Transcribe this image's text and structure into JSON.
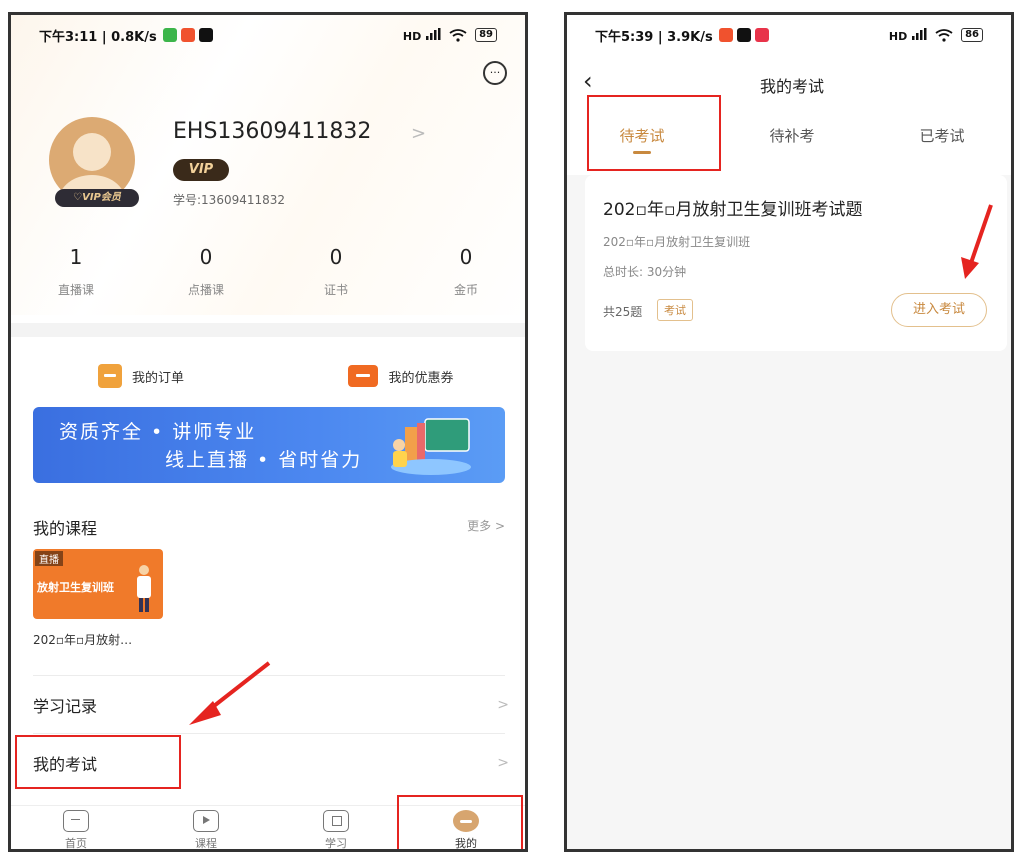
{
  "left": {
    "status": {
      "time_speed": "下午3:11 | 0.8K/s",
      "signal": "HD",
      "battery": "89"
    },
    "profile": {
      "username": "EHS13609411832",
      "vip_badge": "VIP",
      "vip_member_label": "♡VIP会员",
      "student_id": "学号:13609411832"
    },
    "stats": [
      {
        "value": "1",
        "label": "直播课"
      },
      {
        "value": "0",
        "label": "点播课"
      },
      {
        "value": "0",
        "label": "证书"
      },
      {
        "value": "0",
        "label": "金币"
      }
    ],
    "actions": {
      "orders": "我的订单",
      "coupons": "我的优惠券"
    },
    "banner": {
      "line1": "资质齐全 • 讲师专业",
      "line2": "线上直播 • 省时省力"
    },
    "courses": {
      "title": "我的课程",
      "more": "更多 >",
      "item": {
        "tag": "直播",
        "thumb_text": "放射卫生复训班",
        "name": "202▫年▫月放射…"
      }
    },
    "menu": {
      "study_record": "学习记录",
      "my_exams": "我的考试"
    },
    "tabbar": [
      {
        "label": "首页"
      },
      {
        "label": "课程"
      },
      {
        "label": "学习"
      },
      {
        "label": "我的"
      }
    ]
  },
  "right": {
    "status": {
      "time_speed": "下午5:39 | 3.9K/s",
      "signal": "HD",
      "battery": "86"
    },
    "title": "我的考试",
    "tabs": [
      {
        "label": "待考试"
      },
      {
        "label": "待补考"
      },
      {
        "label": "已考试"
      }
    ],
    "exam": {
      "title": "202▫年▫月放射卫生复训班考试题",
      "subtitle": "202▫年▫月放射卫生复训班",
      "duration": "总时长: 30分钟",
      "count": "共25题",
      "tag": "考试",
      "enter": "进入考试"
    }
  },
  "colors": {
    "accent": "#c8893f",
    "annotation_red": "#e52420",
    "banner_blue": "#4c88f0"
  }
}
